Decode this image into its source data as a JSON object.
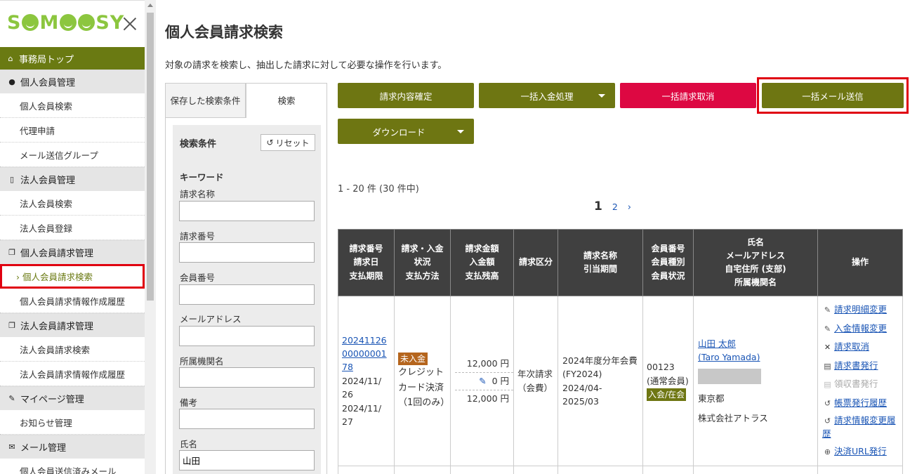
{
  "app": {
    "logo": "SMOOSY"
  },
  "sidebar": {
    "top": {
      "label": "事務局トップ"
    },
    "groups": [
      {
        "label": "個人会員管理",
        "items": [
          "個人会員検索",
          "代理申請",
          "メール送信グループ"
        ]
      },
      {
        "label": "法人会員管理",
        "items": [
          "法人会員検索",
          "法人会員登録"
        ]
      },
      {
        "label": "個人会員請求管理",
        "items": [
          "› 個人会員請求検索",
          "個人会員請求情報作成履歴"
        ]
      },
      {
        "label": "法人会員請求管理",
        "items": [
          "法人会員請求検索",
          "法人会員請求情報作成履歴"
        ]
      },
      {
        "label": "マイページ管理",
        "items": [
          "お知らせ管理"
        ]
      },
      {
        "label": "メール管理",
        "items": [
          "個人会員送信済みメール"
        ]
      }
    ]
  },
  "main": {
    "title": "個人会員請求検索",
    "description": "対象の請求を検索し、抽出した請求に対して必要な操作を行います。"
  },
  "search": {
    "tabs": {
      "saved": "保存した検索条件",
      "search": "検索"
    },
    "condition_title": "検索条件",
    "reset_label": "リセット",
    "keyword_title": "キーワード",
    "fields": {
      "bill_name": {
        "label": "請求名称",
        "value": ""
      },
      "bill_number": {
        "label": "請求番号",
        "value": ""
      },
      "member_number": {
        "label": "会員番号",
        "value": ""
      },
      "email": {
        "label": "メールアドレス",
        "value": ""
      },
      "org": {
        "label": "所属機関名",
        "value": ""
      },
      "note": {
        "label": "備考",
        "value": ""
      },
      "name": {
        "label": "氏名",
        "value": "山田"
      }
    }
  },
  "actions": {
    "confirm": "請求内容確定",
    "bulk_payment": "一括入金処理",
    "bulk_cancel": "一括請求取消",
    "bulk_mail": "一括メール送信",
    "download": "ダウンロード"
  },
  "results": {
    "count_text": "1 - 20 件 (30 件中)",
    "pages": [
      "1",
      "2"
    ],
    "next": "›"
  },
  "table": {
    "headers": {
      "c1": [
        "請求番号",
        "請求日",
        "支払期限"
      ],
      "c2": [
        "請求・入金",
        "状況",
        "支払方法"
      ],
      "c3": [
        "請求金額",
        "入金額",
        "支払残高"
      ],
      "c4": [
        "請求区分"
      ],
      "c5": [
        "請求名称",
        "引当期間"
      ],
      "c6": [
        "会員番号",
        "会員種別",
        "会員状況"
      ],
      "c7": [
        "氏名",
        "メールアドレス",
        "自宅住所 (支部)",
        "所属機関名"
      ],
      "c8": [
        "操作"
      ]
    },
    "row": {
      "bill_number": "2024112600000000178",
      "bill_number_lines": [
        "20241126",
        "00000001",
        "78"
      ],
      "bill_date_lines": [
        "2024/11/",
        "26"
      ],
      "due_lines": [
        "2024/11/",
        "27"
      ],
      "status_badge": "未入金",
      "payment_method": "クレジットカード決済（1回のみ）",
      "amount": "12,000 円",
      "paid": "0 円",
      "balance": "12,000 円",
      "category": "年次請求（会費）",
      "bill_name": "2024年度分年会費(FY2024)",
      "period": "2024/04-2025/03",
      "member_number": "00123",
      "member_type": "(通常会員)",
      "member_status": "入会/在会",
      "name": "山田 太郎",
      "name_en": "(Taro Yamada)",
      "address": "東京都",
      "org": "株式会社アトラス",
      "operations": [
        "請求明細変更",
        "入金情報変更",
        "請求取消",
        "請求書発行",
        "領収書発行",
        "帳票発行履歴",
        "請求情報変更履歴",
        "決済URL発行"
      ]
    }
  },
  "colors": {
    "olive": "#6e7612",
    "red": "#dd0842",
    "highlight": "#e00010",
    "link": "#1a55b5",
    "header": "#404040"
  }
}
